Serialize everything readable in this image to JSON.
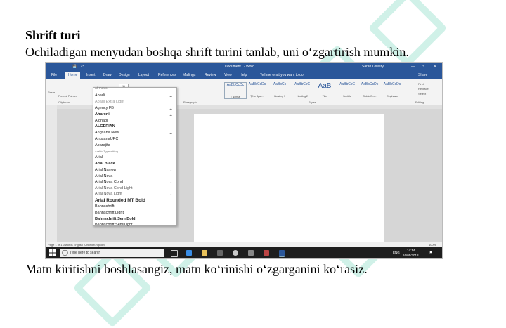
{
  "heading": "Shrift turi",
  "subtitle": "Ochiladigan menyudan boshqa shrift turini tanlab, uni o‘zgartirish mumkin.",
  "bottom_text": "Matn kiritishni boshlasangiz, matn ko‘rinishi o‘zgarganini ko‘rasiz.",
  "word": {
    "window_title": "Document1 - Word",
    "user": "Sarah Lowery",
    "tabs": [
      "File",
      "Home",
      "Insert",
      "Draw",
      "Design",
      "Layout",
      "References",
      "Mailings",
      "Review",
      "View",
      "Help"
    ],
    "tell_me": "Tell me what you want to do",
    "share": "Share",
    "clipboard": {
      "paste": "Paste",
      "format_painter": "Format Painter",
      "group": "Clipboard"
    },
    "font_size": "11",
    "groups": {
      "paragraph": "Paragraph",
      "styles": "Styles",
      "editing": "Editing"
    },
    "styles": [
      {
        "preview": "AaBbCcDc",
        "name": "¶ Normal"
      },
      {
        "preview": "AaBbCcDc",
        "name": "¶ No Spac..."
      },
      {
        "preview": "AaBbCc",
        "name": "Heading 1"
      },
      {
        "preview": "AaBbCcC",
        "name": "Heading 2"
      },
      {
        "preview": "AaB",
        "name": "Title"
      },
      {
        "preview": "AaBbCcC",
        "name": "Subtitle"
      },
      {
        "preview": "AaBbCcDc",
        "name": "Subtle Em..."
      },
      {
        "preview": "AaBbCcDc",
        "name": "Emphasis"
      }
    ],
    "editing_items": [
      "Find",
      "Replace",
      "Select"
    ],
    "font_list": [
      "All Fonts",
      "Abadi",
      "Abadi Extra Light",
      "Agency FB",
      "Aharoni",
      "Aldhabi",
      "ALGERIAN",
      "Angsana New",
      "AngsanaUPC",
      "Aparajita",
      "Arabic Typesetting",
      "Arial",
      "Arial Black",
      "Arial Narrow",
      "Arial Nova",
      "Arial Nova Cond",
      "Arial Nova Cond Light",
      "Arial Nova Light",
      "Arial Rounded MT Bold",
      "Bahnschrift",
      "Bahnschrift Light",
      "Bahnschrift SemiBold",
      "Bahnschrift SemiLight"
    ],
    "status_left": "Page 1 of 1   0 words   English (United Kingdom)",
    "zoom": "100%",
    "taskbar_search": "Type here to search",
    "tray_lang": "ENG",
    "clock_time": "14:14",
    "clock_date": "16/05/2018"
  }
}
